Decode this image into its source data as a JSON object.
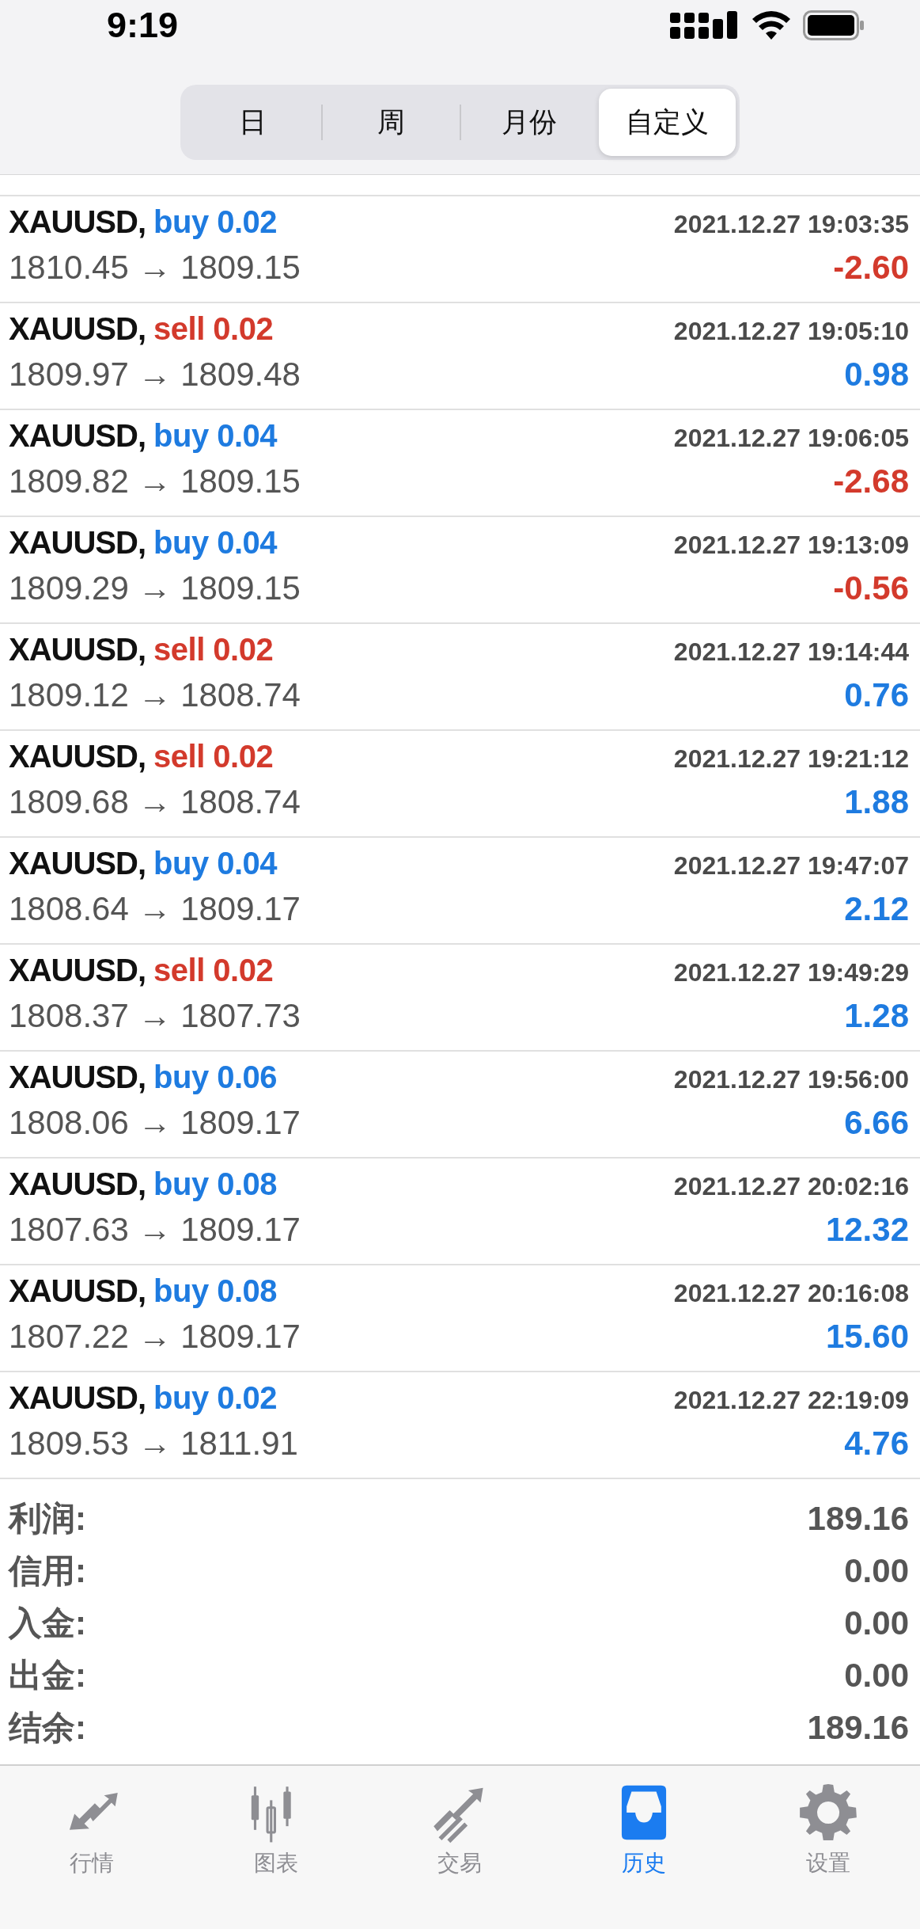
{
  "status_bar": {
    "time": "9:19"
  },
  "period_tabs": [
    {
      "label": "日",
      "selected": false
    },
    {
      "label": "周",
      "selected": false
    },
    {
      "label": "月份",
      "selected": false
    },
    {
      "label": "自定义",
      "selected": true
    }
  ],
  "trades": [
    {
      "symbol": "XAUUSD,",
      "kind": "buy",
      "order": "buy 0.02",
      "time": "2021.12.27 19:03:35",
      "prices": "1810.45 → 1809.15",
      "profit": "-2.60",
      "loss": true
    },
    {
      "symbol": "XAUUSD,",
      "kind": "sell",
      "order": "sell 0.02",
      "time": "2021.12.27 19:05:10",
      "prices": "1809.97 → 1809.48",
      "profit": "0.98",
      "loss": false
    },
    {
      "symbol": "XAUUSD,",
      "kind": "buy",
      "order": "buy 0.04",
      "time": "2021.12.27 19:06:05",
      "prices": "1809.82 → 1809.15",
      "profit": "-2.68",
      "loss": true
    },
    {
      "symbol": "XAUUSD,",
      "kind": "buy",
      "order": "buy 0.04",
      "time": "2021.12.27 19:13:09",
      "prices": "1809.29 → 1809.15",
      "profit": "-0.56",
      "loss": true
    },
    {
      "symbol": "XAUUSD,",
      "kind": "sell",
      "order": "sell 0.02",
      "time": "2021.12.27 19:14:44",
      "prices": "1809.12 → 1808.74",
      "profit": "0.76",
      "loss": false
    },
    {
      "symbol": "XAUUSD,",
      "kind": "sell",
      "order": "sell 0.02",
      "time": "2021.12.27 19:21:12",
      "prices": "1809.68 → 1808.74",
      "profit": "1.88",
      "loss": false
    },
    {
      "symbol": "XAUUSD,",
      "kind": "buy",
      "order": "buy 0.04",
      "time": "2021.12.27 19:47:07",
      "prices": "1808.64 → 1809.17",
      "profit": "2.12",
      "loss": false
    },
    {
      "symbol": "XAUUSD,",
      "kind": "sell",
      "order": "sell 0.02",
      "time": "2021.12.27 19:49:29",
      "prices": "1808.37 → 1807.73",
      "profit": "1.28",
      "loss": false
    },
    {
      "symbol": "XAUUSD,",
      "kind": "buy",
      "order": "buy 0.06",
      "time": "2021.12.27 19:56:00",
      "prices": "1808.06 → 1809.17",
      "profit": "6.66",
      "loss": false
    },
    {
      "symbol": "XAUUSD,",
      "kind": "buy",
      "order": "buy 0.08",
      "time": "2021.12.27 20:02:16",
      "prices": "1807.63 → 1809.17",
      "profit": "12.32",
      "loss": false
    },
    {
      "symbol": "XAUUSD,",
      "kind": "buy",
      "order": "buy 0.08",
      "time": "2021.12.27 20:16:08",
      "prices": "1807.22 → 1809.17",
      "profit": "15.60",
      "loss": false
    },
    {
      "symbol": "XAUUSD,",
      "kind": "buy",
      "order": "buy 0.02",
      "time": "2021.12.27 22:19:09",
      "prices": "1809.53 → 1811.91",
      "profit": "4.76",
      "loss": false
    }
  ],
  "summary": [
    {
      "label": "利润:",
      "value": "189.16"
    },
    {
      "label": "信用:",
      "value": "0.00"
    },
    {
      "label": "入金:",
      "value": "0.00"
    },
    {
      "label": "出金:",
      "value": "0.00"
    },
    {
      "label": "结余:",
      "value": "189.16"
    }
  ],
  "bottom_tabs": [
    {
      "label": "行情",
      "selected": false
    },
    {
      "label": "图表",
      "selected": false
    },
    {
      "label": "交易",
      "selected": false
    },
    {
      "label": "历史",
      "selected": true
    },
    {
      "label": "设置",
      "selected": false
    }
  ]
}
